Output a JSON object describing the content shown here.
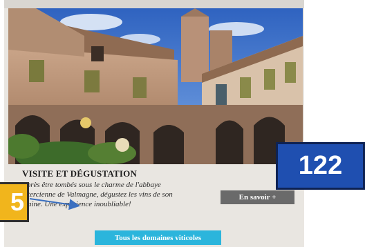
{
  "card": {
    "title": "VISITE ET DÉGUSTATION",
    "description": "Après être tombés sous le charme de l'abbaye\n-stercienne de Valmagne, dégustez les vins de son\nmaine. Une expérience inoubliable!",
    "more_button": "En savoir +",
    "all_button": "Tous les domaines viticoles"
  },
  "badges": {
    "main": "122",
    "side": "5"
  },
  "colors": {
    "card_bg": "#e9e6e1",
    "more_button": "#6a6a6a",
    "all_button": "#2bb5dc",
    "badge_main": "#1f4fb0",
    "badge_side": "#f1b51c",
    "arrow": "#3a6fc0"
  },
  "image": {
    "subject": "abbey-cloister-photo"
  }
}
